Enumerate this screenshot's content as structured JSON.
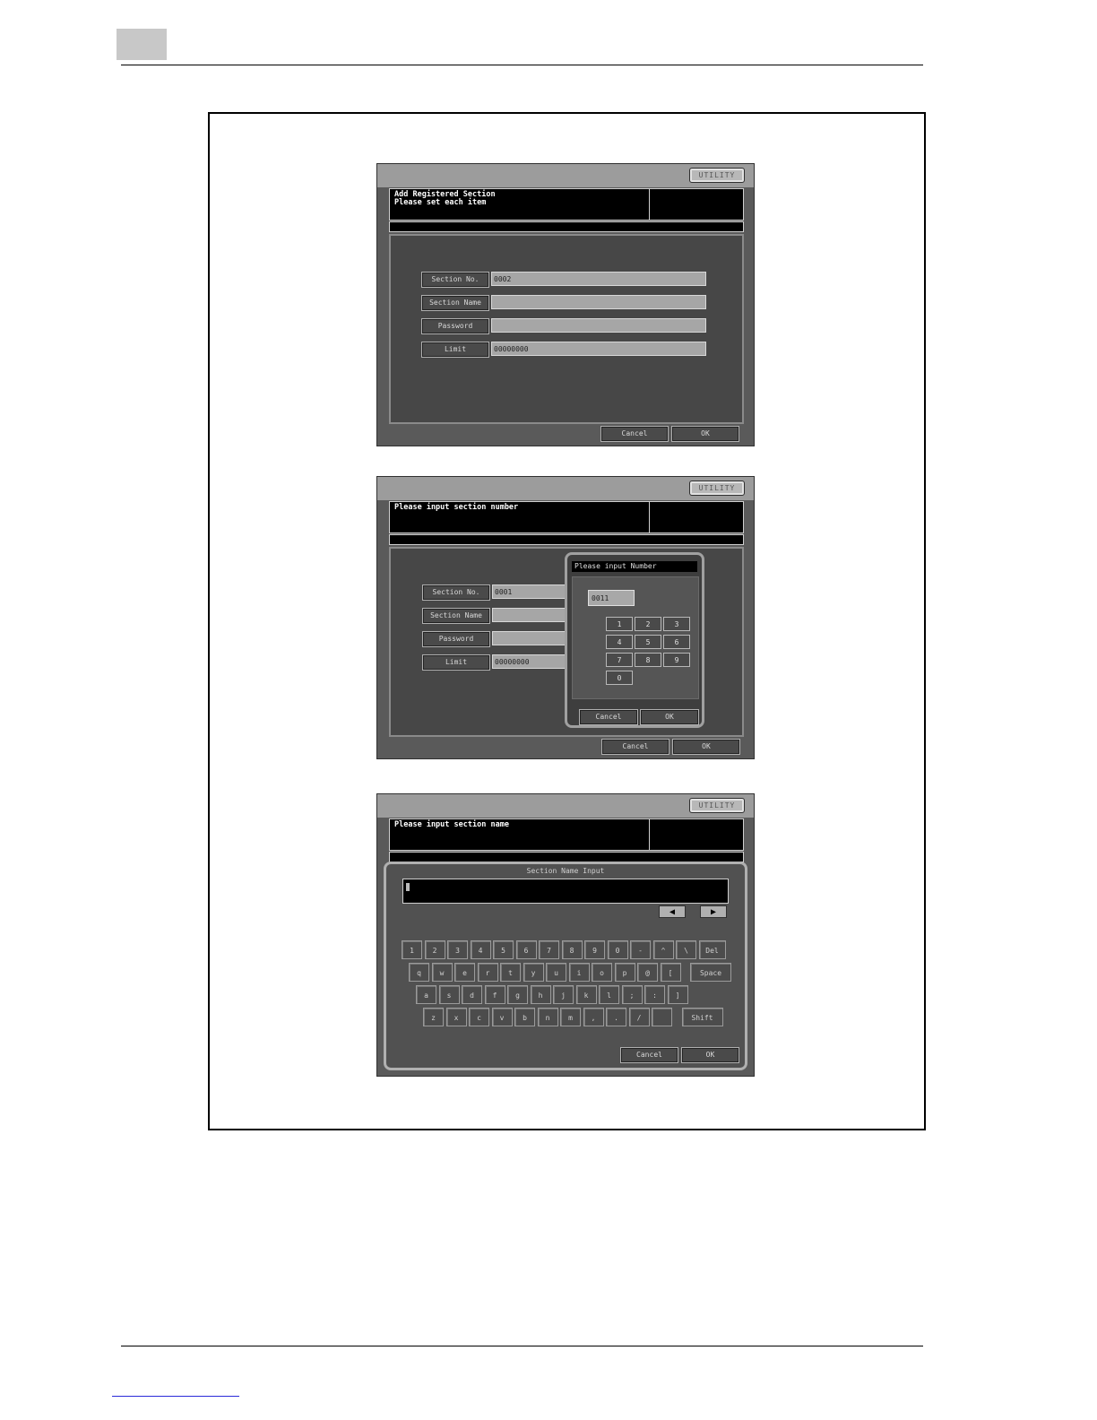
{
  "document": {
    "page_tab": "",
    "footer_link": ""
  },
  "screen1": {
    "utility": "UTILITY",
    "message": "Add Registered Section\nPlease set each item",
    "fields": [
      {
        "label": "Section No.",
        "value": "0002"
      },
      {
        "label": "Section Name",
        "value": ""
      },
      {
        "label": "Password",
        "value": ""
      },
      {
        "label": "Limit",
        "value": "00000000"
      }
    ],
    "cancel": "Cancel",
    "ok": "OK"
  },
  "screen2": {
    "utility": "UTILITY",
    "message": "Please input section number",
    "fields": [
      {
        "label": "Section No.",
        "value": "0001"
      },
      {
        "label": "Section Name",
        "value": ""
      },
      {
        "label": "Password",
        "value": ""
      },
      {
        "label": "Limit",
        "value": "00000000"
      }
    ],
    "numpad": {
      "title": "Please input Number",
      "display": "0011",
      "keys": [
        "1",
        "2",
        "3",
        "4",
        "5",
        "6",
        "7",
        "8",
        "9",
        "0"
      ],
      "cancel": "Cancel",
      "ok": "OK"
    },
    "cancel": "Cancel",
    "ok": "OK"
  },
  "screen3": {
    "utility": "UTILITY",
    "message": "Please input section name",
    "keyboard": {
      "title": "Section Name Input",
      "left_arrow": "◀",
      "right_arrow": "▶",
      "rows": [
        [
          "1",
          "2",
          "3",
          "4",
          "5",
          "6",
          "7",
          "8",
          "9",
          "0",
          "-",
          "^",
          "\\",
          "Del"
        ],
        [
          "q",
          "w",
          "e",
          "r",
          "t",
          "y",
          "u",
          "i",
          "o",
          "p",
          "@",
          "[",
          "Space"
        ],
        [
          "a",
          "s",
          "d",
          "f",
          "g",
          "h",
          "j",
          "k",
          "l",
          ";",
          ":",
          "]"
        ],
        [
          "z",
          "x",
          "c",
          "v",
          "b",
          "n",
          "m",
          ",",
          ".",
          "/",
          "",
          "Shift"
        ]
      ],
      "cancel": "Cancel",
      "ok": "OK"
    }
  },
  "colors": {
    "screen_bg": "#5a5a5a",
    "inner_bg": "#474747",
    "message_bg": "#000000",
    "field_bg": "#a6a6a6"
  }
}
